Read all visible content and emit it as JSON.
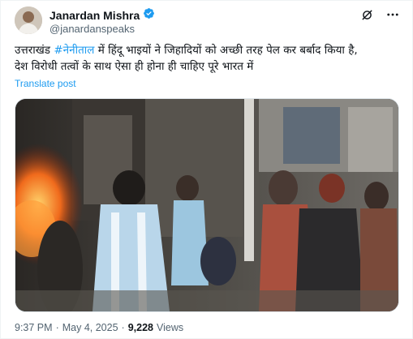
{
  "tweet": {
    "author_name": "Janardan Mishra",
    "handle": "@janardanspeaks",
    "verified": true,
    "text_line1_prefix": "उत्तराखंड ",
    "hashtag": "#नेनीताल",
    "text_line1_suffix": " में हिंदू भाइयों ने जिहादियों को अच्छी तरह पेल कर बर्बाद किया है,",
    "text_line2": "देश विरोधी तत्वों के साथ ऐसा ही होना ही चाहिए पूरे भारत में",
    "translate_label": "Translate post",
    "time": "9:37 PM",
    "separator": "·",
    "date": "May 4, 2025",
    "views_count": "9,228",
    "views_label": "Views"
  },
  "icons": {
    "verified": "verified-badge-icon",
    "grok": "grok-icon",
    "more": "more-options-icon"
  },
  "colors": {
    "accent": "#1d9bf0",
    "text": "#0f1419",
    "secondary": "#536471"
  }
}
